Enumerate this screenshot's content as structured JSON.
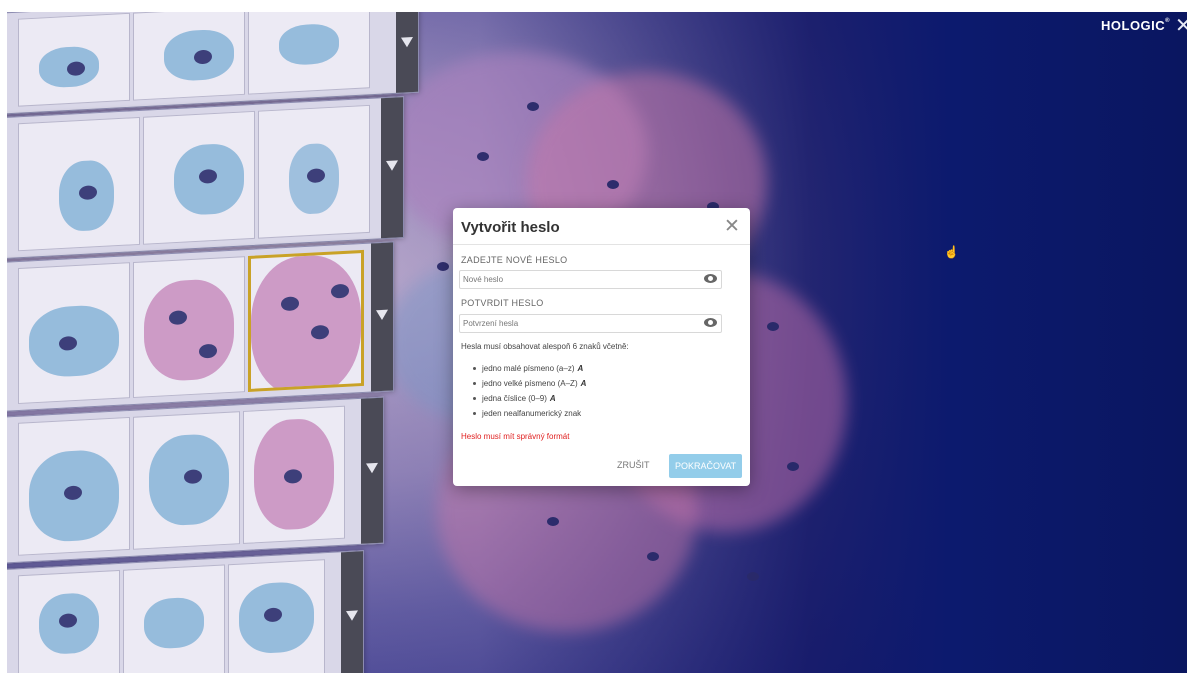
{
  "app": {
    "brand": "HOLOGIC",
    "brand_mark": "®",
    "close_label": "✕",
    "accent": "#93cdea",
    "bg_dark": "#0c1a6e"
  },
  "dialog": {
    "title": "Vytvořit heslo",
    "close_label": "✕",
    "new_password": {
      "label": "ZADEJTE NOVÉ HESLO",
      "placeholder": "Nové heslo",
      "value": "",
      "icon": "eye-icon"
    },
    "confirm_password": {
      "label": "POTVRDIT HESLO",
      "placeholder": "Potvrzení hesla",
      "value": "",
      "icon": "eye-icon"
    },
    "requirements_title": "Hesla musí obsahovat alespoň 6 znaků včetně:",
    "requirements": [
      {
        "text": "jedno malé písmeno (a–z)",
        "mark": "A"
      },
      {
        "text": "jedno velké písmeno (A–Z)",
        "mark": "A"
      },
      {
        "text": "jedna číslice (0–9)",
        "mark": "A"
      },
      {
        "text": "jeden nealfanumerický znak",
        "mark": ""
      }
    ],
    "error": "Heslo musí mít správný formát",
    "error_color": "#e02020",
    "cancel_label": "ZRUŠIT",
    "continue_label": "POKRAČOVAT"
  }
}
